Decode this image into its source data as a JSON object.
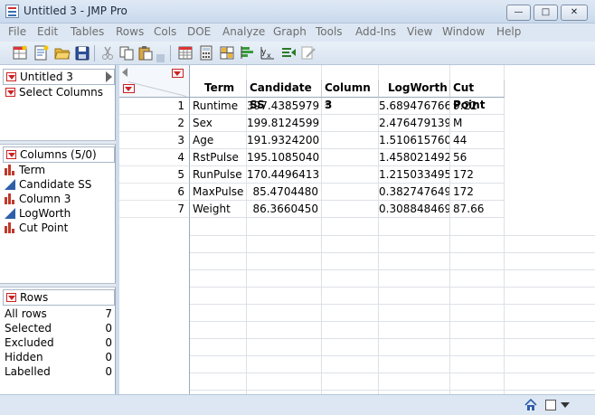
{
  "window": {
    "title": "Untitled 3 - JMP Pro",
    "min_glyph": "—",
    "max_glyph": "□",
    "close_glyph": "✕"
  },
  "menu": [
    "File",
    "Edit",
    "Tables",
    "Rows",
    "Cols",
    "DOE",
    "Analyze",
    "Graph",
    "Tools",
    "Add-Ins",
    "View",
    "Window",
    "Help"
  ],
  "toolbar": {
    "icons": [
      "new-data-table-icon",
      "new-script-icon",
      "open-icon",
      "save-icon",
      "cut-icon",
      "copy-icon",
      "paste-icon",
      "data-table-icon",
      "calculator-icon",
      "grid-icon",
      "distribution-icon",
      "fit-y-by-x-icon",
      "fit-model-icon",
      "edit-icon"
    ]
  },
  "left_panel": {
    "table_name": "Untitled 3",
    "select_columns": "Select Columns",
    "columns_header": "Columns (5/0)",
    "columns": [
      {
        "name": "Term",
        "type": "nominal"
      },
      {
        "name": "Candidate SS",
        "type": "continuous"
      },
      {
        "name": "Column 3",
        "type": "nominal"
      },
      {
        "name": "LogWorth",
        "type": "continuous"
      },
      {
        "name": "Cut Point",
        "type": "nominal"
      }
    ],
    "rows_header": "Rows",
    "rows_stats": [
      {
        "label": "All rows",
        "value": "7"
      },
      {
        "label": "Selected",
        "value": "0"
      },
      {
        "label": "Excluded",
        "value": "0"
      },
      {
        "label": "Hidden",
        "value": "0"
      },
      {
        "label": "Labelled",
        "value": "0"
      }
    ]
  },
  "table": {
    "headers": [
      "Term",
      "Candidate SS",
      "Column 3",
      "LogWorth",
      "Cut Point"
    ],
    "rows": [
      {
        "n": "1",
        "term": "Runtime",
        "ss": "397.4385979",
        "col3": "*",
        "logworth": "5.689476766",
        "cut": "9.22"
      },
      {
        "n": "2",
        "term": "Sex",
        "ss": "199.8124599",
        "col3": "",
        "logworth": "2.476479139",
        "cut": "M"
      },
      {
        "n": "3",
        "term": "Age",
        "ss": "191.9324200",
        "col3": "",
        "logworth": "1.510615760",
        "cut": "44"
      },
      {
        "n": "4",
        "term": "RstPulse",
        "ss": "195.1085040",
        "col3": "",
        "logworth": "1.458021492",
        "cut": "56"
      },
      {
        "n": "5",
        "term": "RunPulse",
        "ss": "170.4496413",
        "col3": "",
        "logworth": "1.215033495",
        "cut": "172"
      },
      {
        "n": "6",
        "term": "MaxPulse",
        "ss": "85.4704480",
        "col3": "",
        "logworth": "0.382747649",
        "cut": "172"
      },
      {
        "n": "7",
        "term": "Weight",
        "ss": "86.3660450",
        "col3": "",
        "logworth": "0.308848469",
        "cut": "87.66"
      }
    ]
  },
  "status_icons": [
    "home-icon",
    "window-list-icon",
    "dropdown-icon"
  ]
}
